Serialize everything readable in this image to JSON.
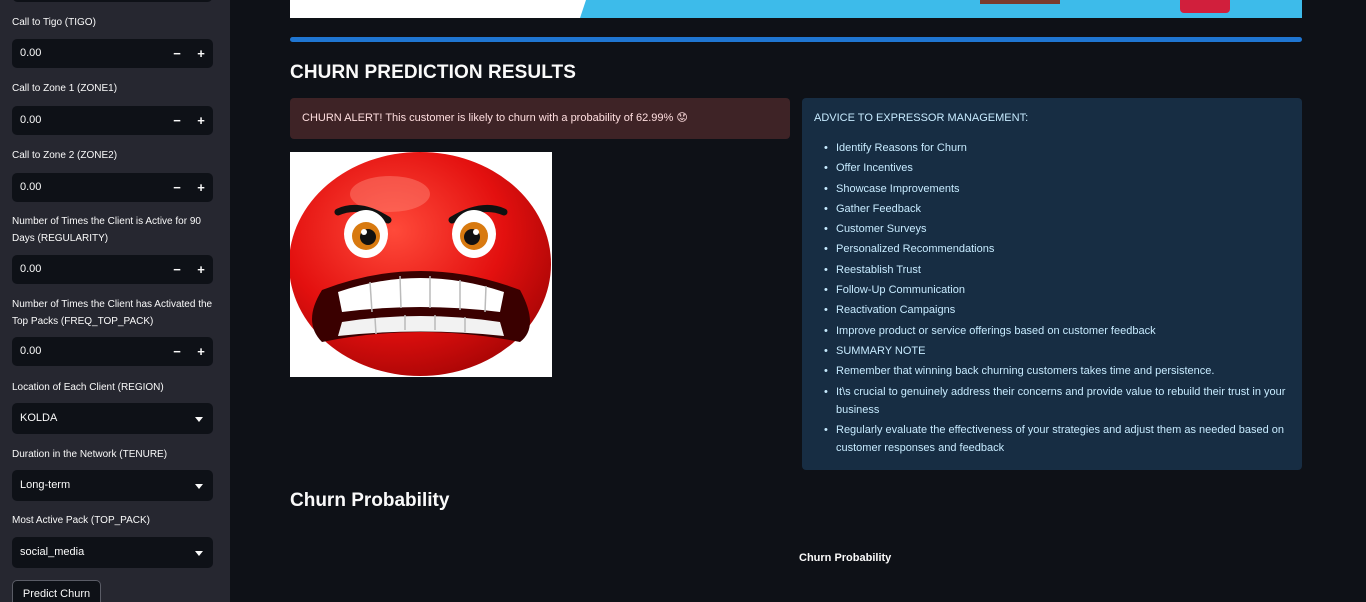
{
  "sidebar": {
    "inputs": [
      {
        "label": "Call to Tigo (TIGO)",
        "value": "0.00"
      },
      {
        "label": "Call to Zone 1 (ZONE1)",
        "value": "0.00"
      },
      {
        "label": "Call to Zone 2 (ZONE2)",
        "value": "0.00"
      },
      {
        "label": "Number of Times the Client is Active for 90 Days (REGULARITY)",
        "value": "0.00"
      },
      {
        "label": "Number of Times the Client has Activated the Top Packs (FREQ_TOP_PACK)",
        "value": "0.00"
      }
    ],
    "stepper": {
      "minus": "−",
      "plus": "+"
    },
    "selects": [
      {
        "label": "Location of Each Client (REGION)",
        "value": "KOLDA"
      },
      {
        "label": "Duration in the Network (TENURE)",
        "value": "Long-term"
      },
      {
        "label": "Most Active Pack (TOP_PACK)",
        "value": "social_media"
      }
    ],
    "predict_label": "Predict Churn"
  },
  "main": {
    "results_title": "CHURN PREDICTION RESULTS",
    "alert": "CHURN ALERT! This customer is likely to churn with a probability of 62.99% 😟",
    "advice_title": "ADVICE TO EXPRESSOR MANAGEMENT:",
    "advice_items": [
      "Identify Reasons for Churn",
      "Offer Incentives",
      "Showcase Improvements",
      "Gather Feedback",
      "Customer Surveys",
      "Personalized Recommendations",
      "Reestablish Trust",
      "Follow-Up Communication",
      "Reactivation Campaigns",
      "Improve product or service offerings based on customer feedback",
      "SUMMARY NOTE",
      "Remember that winning back churning customers takes time and persistence.",
      "It\\s crucial to genuinely address their concerns and provide value to rebuild their trust in your business",
      "Regularly evaluate the effectiveness of your strategies and adjust them as needed based on customer responses and feedback"
    ],
    "probability_heading": "Churn Probability",
    "chart_title": "Churn Probability"
  },
  "colors": {
    "background": "#0e1117",
    "sidebar": "#262730",
    "progress": "#1f76d2",
    "alert_bg": "#3e2326",
    "advice_bg": "#172d43",
    "face_red": "#e3100f"
  },
  "icons": {
    "angry_face": "angry-red-emoji",
    "dropdown": "chevron-down-icon"
  }
}
